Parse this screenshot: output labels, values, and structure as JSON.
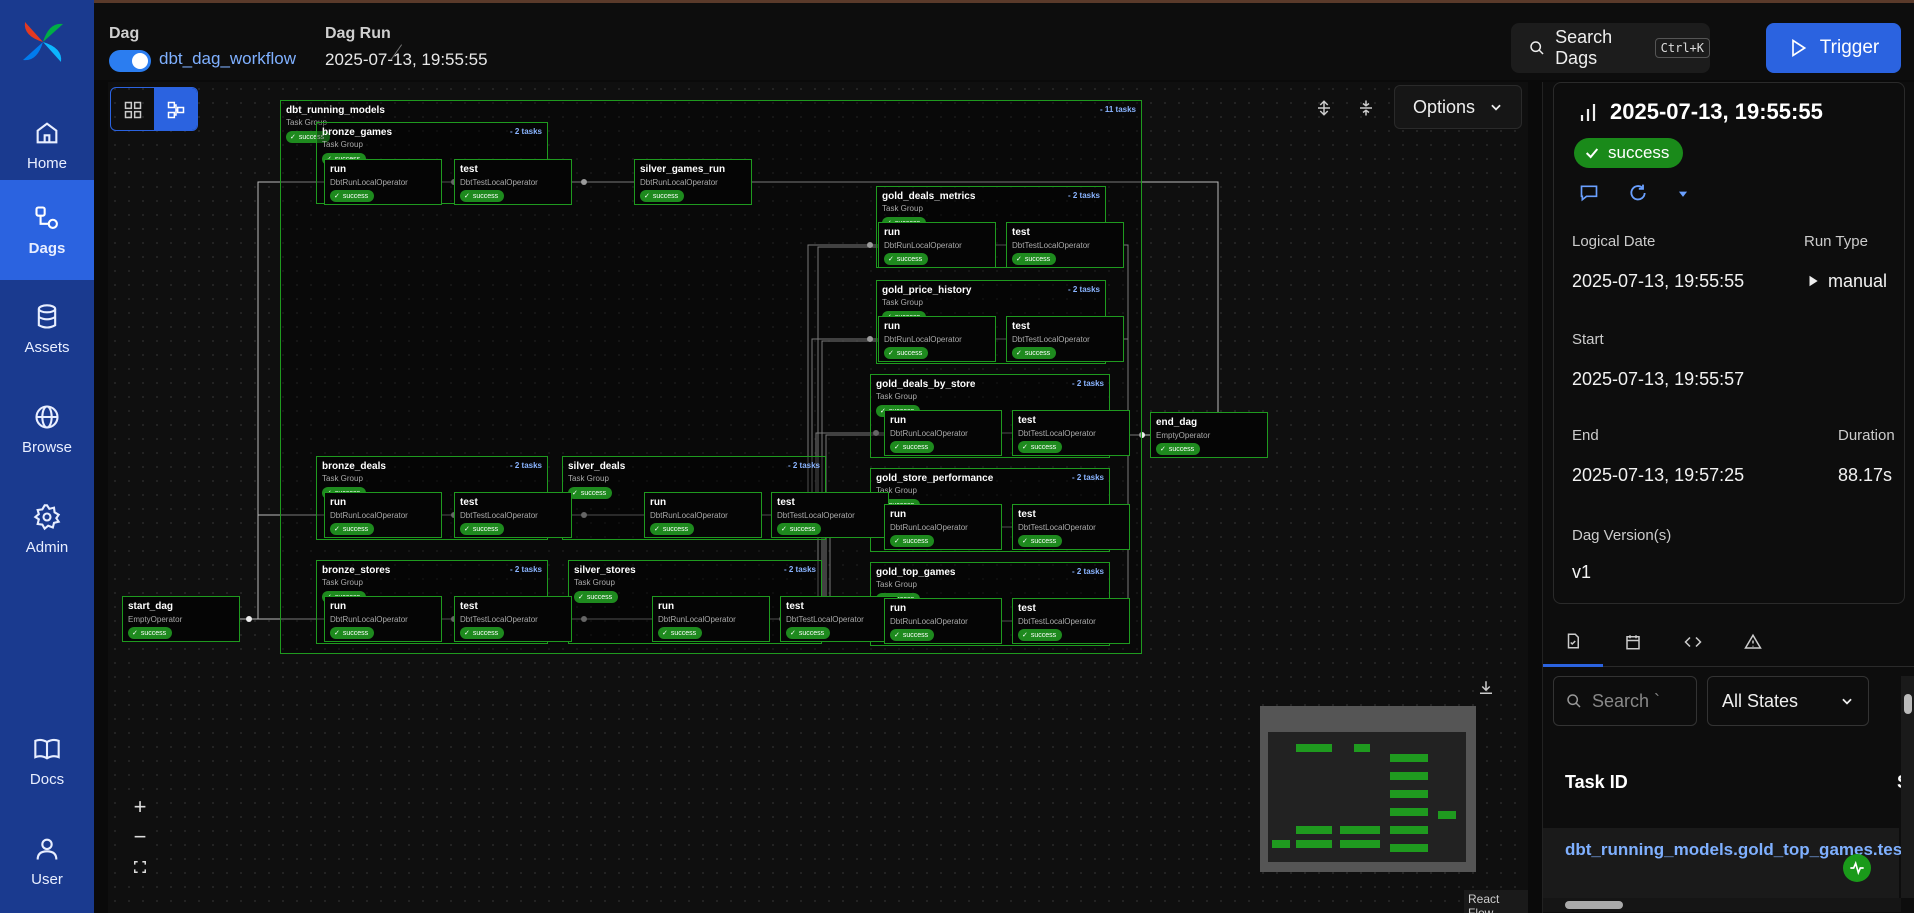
{
  "sidebar": {
    "items": [
      {
        "label": "Home",
        "icon": "home-icon"
      },
      {
        "label": "Dags",
        "icon": "dags-icon",
        "active": true
      },
      {
        "label": "Assets",
        "icon": "database-icon"
      },
      {
        "label": "Browse",
        "icon": "globe-icon"
      },
      {
        "label": "Admin",
        "icon": "gear-icon"
      },
      {
        "label": "Docs",
        "icon": "book-icon"
      },
      {
        "label": "User",
        "icon": "user-icon"
      }
    ]
  },
  "header": {
    "dag_label": "Dag",
    "dag_name": "dbt_dag_workflow",
    "run_label": "Dag Run",
    "run_value": "2025-07-13, 19:55:55",
    "search_label": "Search Dags",
    "shortcut": "Ctrl+K",
    "trigger_label": "Trigger"
  },
  "graph": {
    "options_label": "Options",
    "react_flow": "React Flow",
    "groups": [
      {
        "id": "dbt_running_models",
        "name": "dbt_running_models",
        "sub": "Task Group",
        "count": "- 11 tasks",
        "status": "success"
      },
      {
        "id": "bronze_games",
        "name": "bronze_games",
        "sub": "Task Group",
        "count": "- 2 tasks",
        "status": "success"
      },
      {
        "id": "bronze_deals",
        "name": "bronze_deals",
        "sub": "Task Group",
        "count": "- 2 tasks",
        "status": "success"
      },
      {
        "id": "bronze_stores",
        "name": "bronze_stores",
        "sub": "Task Group",
        "count": "- 2 tasks",
        "status": "success"
      },
      {
        "id": "silver_deals",
        "name": "silver_deals",
        "sub": "Task Group",
        "count": "- 2 tasks",
        "status": "success"
      },
      {
        "id": "silver_stores",
        "name": "silver_stores",
        "sub": "Task Group",
        "count": "- 2 tasks",
        "status": "success"
      },
      {
        "id": "gold_deals_metrics",
        "name": "gold_deals_metrics",
        "sub": "Task Group",
        "count": "- 2 tasks",
        "status": "success"
      },
      {
        "id": "gold_price_history",
        "name": "gold_price_history",
        "sub": "Task Group",
        "count": "- 2 tasks",
        "status": "success"
      },
      {
        "id": "gold_deals_by_store",
        "name": "gold_deals_by_store",
        "sub": "Task Group",
        "count": "- 2 tasks",
        "status": "success"
      },
      {
        "id": "gold_store_performance",
        "name": "gold_store_performance",
        "sub": "Task Group",
        "count": "- 2 tasks",
        "status": "success"
      },
      {
        "id": "gold_top_games",
        "name": "gold_top_games",
        "sub": "Task Group",
        "count": "- 2 tasks",
        "status": "success"
      }
    ],
    "tasks": [
      {
        "id": "start_dag",
        "name": "start_dag",
        "op": "EmptyOperator",
        "status": "success"
      },
      {
        "id": "end_dag",
        "name": "end_dag",
        "op": "EmptyOperator",
        "status": "success"
      },
      {
        "id": "silver_games_run",
        "name": "silver_games_run",
        "op": "DbtRunLocalOperator",
        "status": "success"
      },
      {
        "id": "bg_run",
        "name": "run",
        "op": "DbtRunLocalOperator",
        "status": "success"
      },
      {
        "id": "bg_test",
        "name": "test",
        "op": "DbtTestLocalOperator",
        "status": "success"
      },
      {
        "id": "bd_run",
        "name": "run",
        "op": "DbtRunLocalOperator",
        "status": "success"
      },
      {
        "id": "bd_test",
        "name": "test",
        "op": "DbtTestLocalOperator",
        "status": "success"
      },
      {
        "id": "bs_run",
        "name": "run",
        "op": "DbtRunLocalOperator",
        "status": "success"
      },
      {
        "id": "bs_test",
        "name": "test",
        "op": "DbtTestLocalOperator",
        "status": "success"
      },
      {
        "id": "sd_run",
        "name": "run",
        "op": "DbtRunLocalOperator",
        "status": "success"
      },
      {
        "id": "sd_test",
        "name": "test",
        "op": "DbtTestLocalOperator",
        "status": "success"
      },
      {
        "id": "ss_run",
        "name": "run",
        "op": "DbtRunLocalOperator",
        "status": "success"
      },
      {
        "id": "ss_test",
        "name": "test",
        "op": "DbtTestLocalOperator",
        "status": "success"
      },
      {
        "id": "gdm_run",
        "name": "run",
        "op": "DbtRunLocalOperator",
        "status": "success"
      },
      {
        "id": "gdm_test",
        "name": "test",
        "op": "DbtTestLocalOperator",
        "status": "success"
      },
      {
        "id": "gph_run",
        "name": "run",
        "op": "DbtRunLocalOperator",
        "status": "success"
      },
      {
        "id": "gph_test",
        "name": "test",
        "op": "DbtTestLocalOperator",
        "status": "success"
      },
      {
        "id": "gdbs_run",
        "name": "run",
        "op": "DbtRunLocalOperator",
        "status": "success"
      },
      {
        "id": "gdbs_test",
        "name": "test",
        "op": "DbtTestLocalOperator",
        "status": "success"
      },
      {
        "id": "gsp_run",
        "name": "run",
        "op": "DbtRunLocalOperator",
        "status": "success"
      },
      {
        "id": "gsp_test",
        "name": "test",
        "op": "DbtTestLocalOperator",
        "status": "success"
      },
      {
        "id": "gtg_run",
        "name": "run",
        "op": "DbtRunLocalOperator",
        "status": "success"
      },
      {
        "id": "gtg_test",
        "name": "test",
        "op": "DbtTestLocalOperator",
        "status": "success"
      }
    ]
  },
  "run": {
    "title": "2025-07-13, 19:55:55",
    "status": "success",
    "logical_date_label": "Logical Date",
    "logical_date": "2025-07-13, 19:55:55",
    "run_type_label": "Run Type",
    "run_type": "manual",
    "start_label": "Start",
    "start": "2025-07-13, 19:55:57",
    "end_label": "End",
    "end": "2025-07-13, 19:57:25",
    "duration_label": "Duration",
    "duration": "88.17s",
    "version_label": "Dag Version(s)",
    "version": "v1"
  },
  "tasklist": {
    "search_placeholder": "Search `",
    "states_label": "All States",
    "col_task_id": "Task ID",
    "col_state": "St",
    "row_task": "dbt_running_models.gold_top_games.test"
  },
  "colors": {
    "accent": "#2b63e0",
    "success": "#1e8a1e",
    "sidebar": "#1a3a8f"
  }
}
